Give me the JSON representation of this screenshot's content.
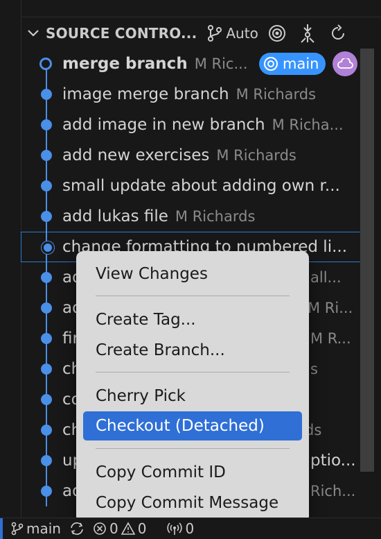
{
  "header": {
    "title": "SOURCE CONTRO...",
    "auto_label": "Auto"
  },
  "graph": {
    "rows": [
      {
        "message": "merge branch",
        "author": "M Ric...",
        "bold": true,
        "head": true
      },
      {
        "message": "image merge branch",
        "author": "M Richards"
      },
      {
        "message": "add image in new branch",
        "author": "M Richa..."
      },
      {
        "message": "add new exercises",
        "author": "M Richards"
      },
      {
        "message": "small update about adding own r...",
        "author": ""
      },
      {
        "message": "add lukas file",
        "author": "M Richards"
      },
      {
        "message": "change formatting to numbered li...",
        "author": "",
        "selected": true
      },
      {
        "message": "ad",
        "author": "all..."
      },
      {
        "message": "ad",
        "author": "M Ri..."
      },
      {
        "message": "fir",
        "author": "M R..."
      },
      {
        "message": "ch",
        "author": "s"
      },
      {
        "message": "co",
        "author": ""
      },
      {
        "message": "ch",
        "author": "ds"
      },
      {
        "message": "up",
        "author": "ptio..."
      },
      {
        "message": "ad",
        "author": "Rich..."
      }
    ],
    "badge_branch": "main"
  },
  "context_menu": {
    "items": [
      {
        "label": "View Changes"
      },
      {
        "label": "Create Tag..."
      },
      {
        "label": "Create Branch..."
      },
      {
        "label": "Cherry Pick"
      },
      {
        "label": "Checkout (Detached)",
        "active": true
      },
      {
        "label": "Copy Commit ID"
      },
      {
        "label": "Copy Commit Message"
      }
    ]
  },
  "status_bar": {
    "branch": "main",
    "errors": "0",
    "warnings": "0",
    "ports": "0"
  },
  "colors": {
    "accent": "#3794ff",
    "menu_highlight": "#2f6fd6",
    "cloud_badge": "#b180d7",
    "graph_line": "#4a8fe8"
  }
}
